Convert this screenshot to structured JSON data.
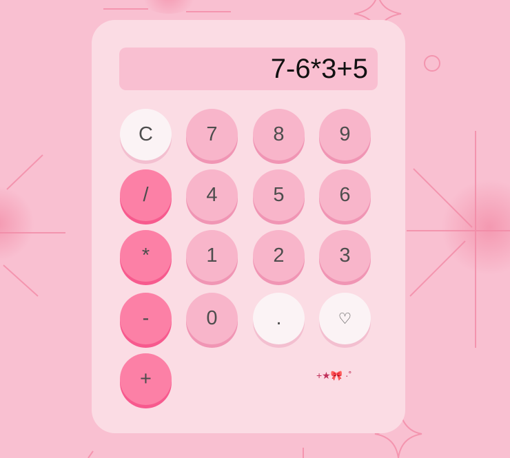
{
  "display": {
    "expression": "7-6*3+5"
  },
  "keys": {
    "clear": "C",
    "seven": "7",
    "eight": "8",
    "nine": "9",
    "divide": "/",
    "four": "4",
    "five": "5",
    "six": "6",
    "multiply": "*",
    "one": "1",
    "two": "2",
    "three": "3",
    "subtract": "-",
    "zero": "0",
    "decimal": ".",
    "heart": "♡",
    "add": "+"
  },
  "decoration": {
    "text": "+★🎀 ·˚"
  },
  "colors": {
    "background": "#f9c0d1",
    "panel": "#fbdce4",
    "display": "#f9bfd1",
    "number_key": "#f8b5ca",
    "operator_key": "#fc80a6",
    "light_key": "#fbf3f5"
  }
}
